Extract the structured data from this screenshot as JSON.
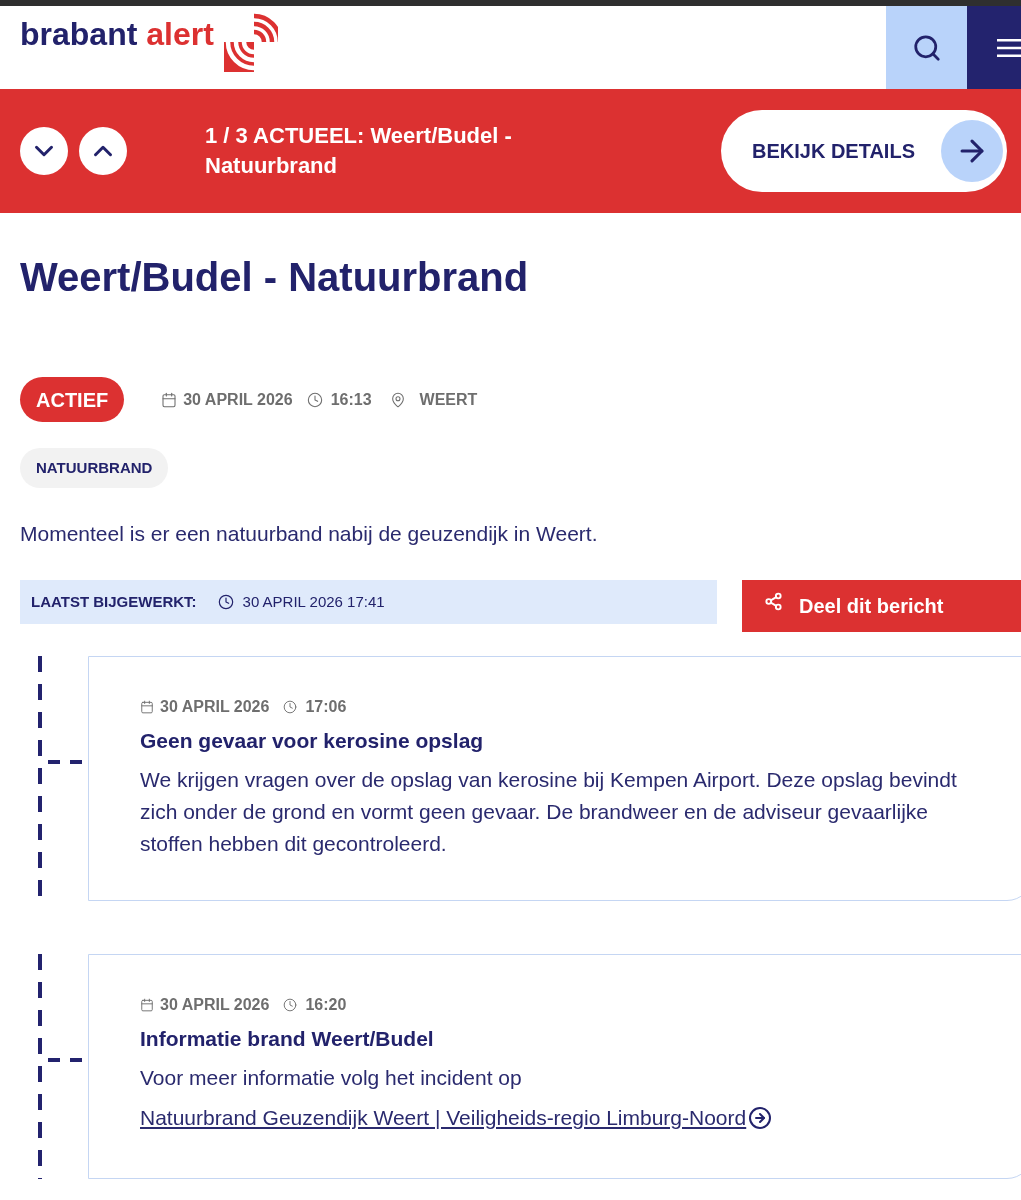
{
  "header": {
    "logo": {
      "primary": "brabant",
      "accent": "alert"
    }
  },
  "alert_banner": {
    "text": "1 / 3 ACTUEEL: Weert/Budel - Natuurbrand",
    "button": "BEKIJK DETAILS"
  },
  "article": {
    "title": "Weert/Budel - Natuurbrand",
    "status": "ACTIEF",
    "date": "30 APRIL 2026",
    "time": "16:13",
    "location": "WEERT",
    "tags": [
      "NATUURBRAND"
    ],
    "description": "Momenteel is er een natuurband nabij de geuzendijk in Weert.",
    "last_updated": {
      "label": "LAATST BIJGEWERKT:",
      "value": "30 APRIL 2026 17:41"
    },
    "share_button": "Deel dit bericht"
  },
  "timeline": [
    {
      "date": "30 APRIL 2026",
      "time": "17:06",
      "title": "Geen gevaar voor kerosine opslag",
      "body": "We krijgen vragen over de opslag van kerosine bij Kempen Airport. Deze opslag bevindt zich onder de grond en vormt geen gevaar. De brandweer en de adviseur gevaarlijke stoffen hebben dit gecontroleerd."
    },
    {
      "date": "30 APRIL 2026",
      "time": "16:20",
      "title": "Informatie brand Weert/Budel",
      "body": "Voor meer informatie volg het incident op",
      "link": "Natuurbrand Geuzendijk Weert | Veiligheids-regio Limburg-Noord"
    }
  ]
}
